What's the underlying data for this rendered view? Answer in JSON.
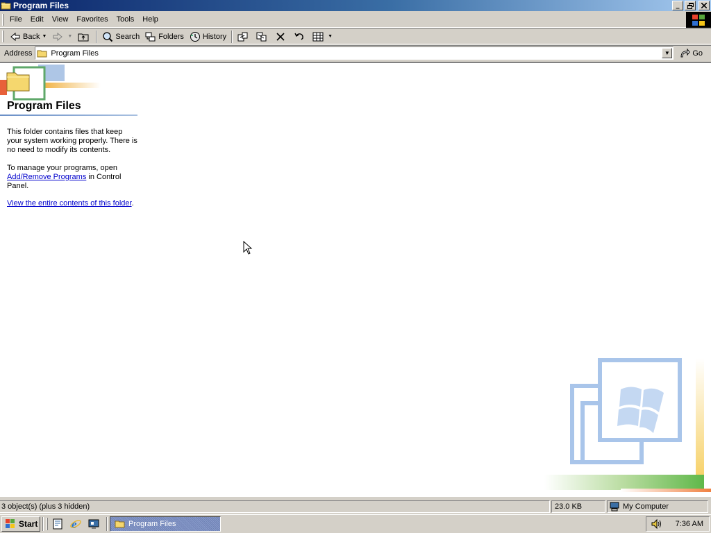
{
  "window": {
    "title": "Program Files"
  },
  "menu": {
    "items": [
      "File",
      "Edit",
      "View",
      "Favorites",
      "Tools",
      "Help"
    ]
  },
  "toolbar": {
    "back_label": "Back",
    "search_label": "Search",
    "folders_label": "Folders",
    "history_label": "History"
  },
  "address": {
    "label": "Address",
    "value": "Program Files",
    "go_label": "Go"
  },
  "content": {
    "heading": "Program Files",
    "p1": "This folder contains files that keep your system working properly. There is no need to modify its contents.",
    "p2_before": "To manage your programs, open ",
    "p2_link": "Add/Remove Programs",
    "p2_after": " in Control Panel.",
    "p3_link": "View the entire contents of this folder",
    "p3_after": "."
  },
  "statusbar": {
    "objects": "3 object(s) (plus 3 hidden)",
    "size": "23.0 KB",
    "zone": "My Computer"
  },
  "taskbar": {
    "start_label": "Start",
    "task_label": "Program Files",
    "clock": "7:36 AM"
  },
  "colors": {
    "titlebar_start": "#0a246a",
    "titlebar_end": "#a6caf0",
    "link": "#0000cc",
    "face": "#d4d0c8"
  }
}
